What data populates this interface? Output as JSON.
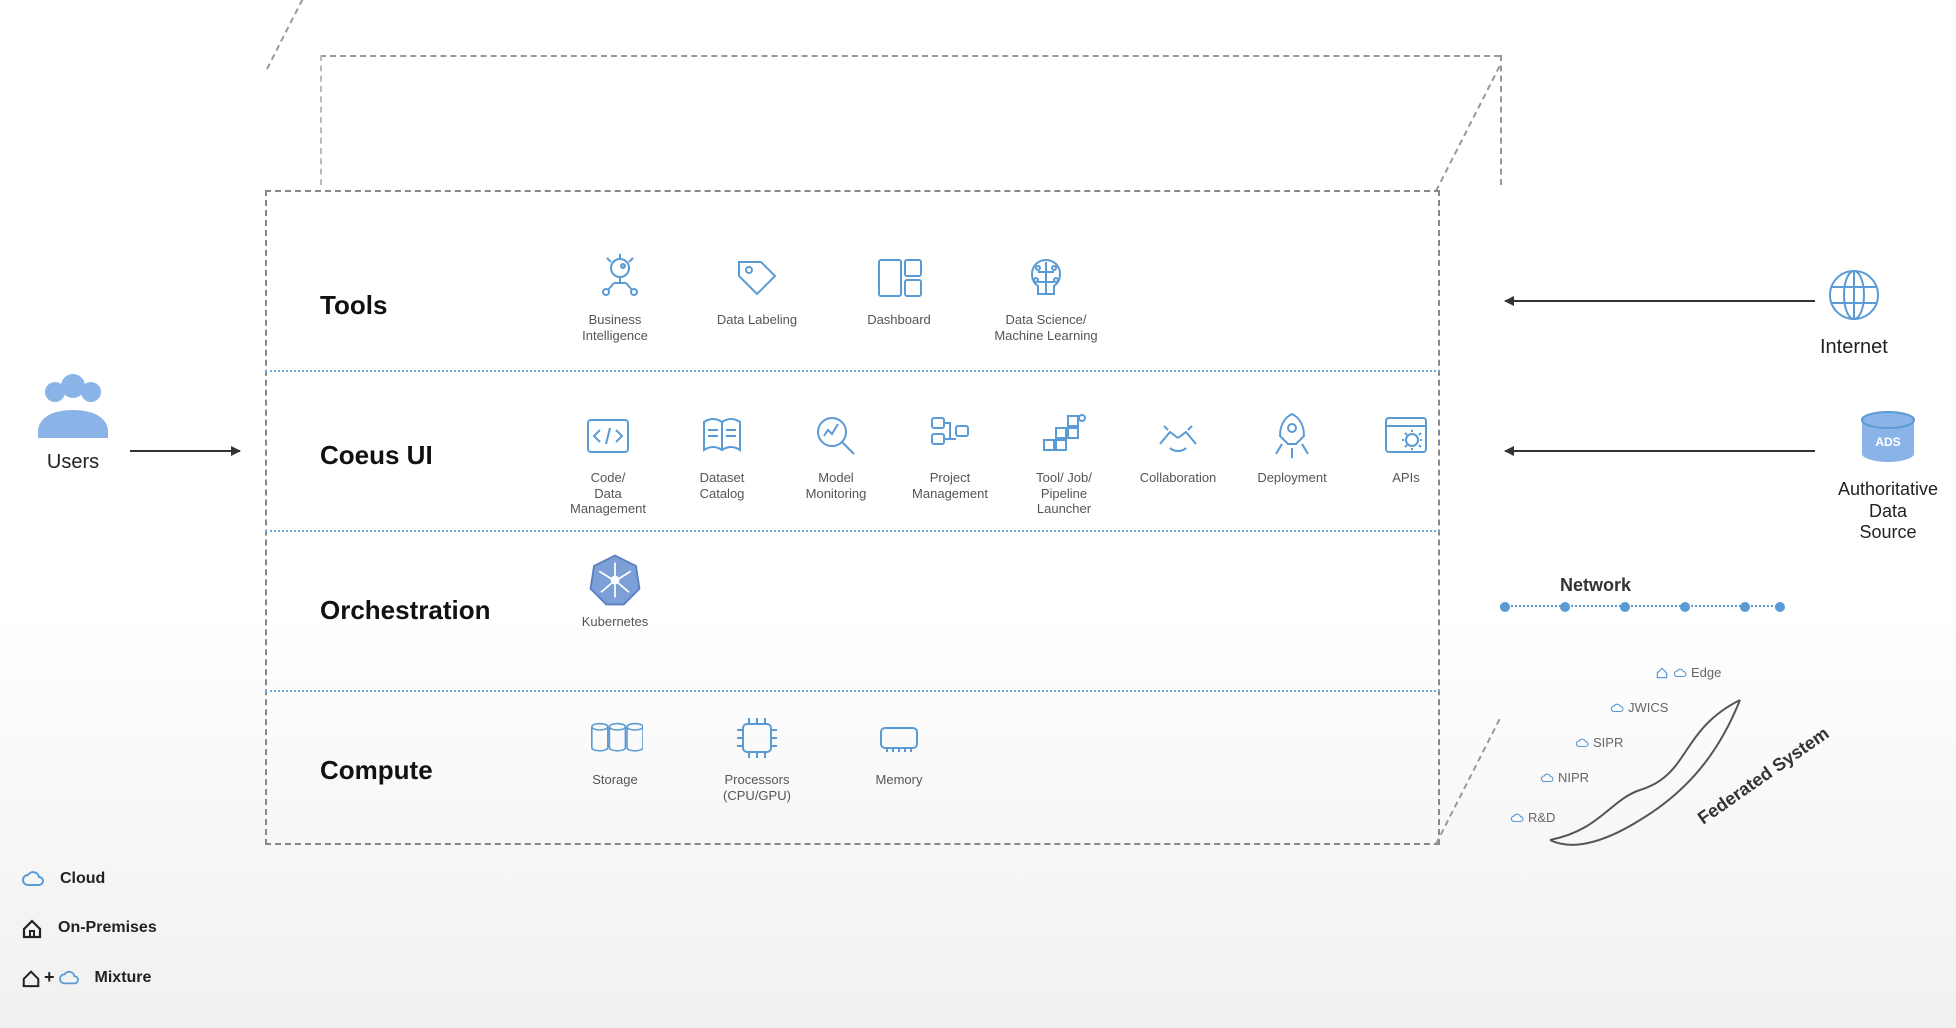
{
  "left": {
    "users": "Users"
  },
  "layers": {
    "tools": "Tools",
    "coeus": "Coeus UI",
    "orch": "Orchestration",
    "compute": "Compute"
  },
  "tools": {
    "bi": "Business\nIntelligence",
    "labeling": "Data Labeling",
    "dashboard": "Dashboard",
    "ml": "Data Science/\nMachine Learning"
  },
  "coeus": {
    "code": "Code/\nData Management",
    "catalog": "Dataset\nCatalog",
    "monitor": "Model\nMonitoring",
    "project": "Project\nManagement",
    "pipeline": "Tool/ Job/\nPipeline Launcher",
    "collab": "Collaboration",
    "deploy": "Deployment",
    "apis": "APIs"
  },
  "orch": {
    "k8s": "Kubernetes"
  },
  "compute": {
    "storage": "Storage",
    "proc": "Processors\n(CPU/GPU)",
    "memory": "Memory"
  },
  "right": {
    "internet": "Internet",
    "ads": "Authoritative Data\nSource",
    "ads_badge": "ADS"
  },
  "network": {
    "label": "Network",
    "tiers": [
      "R&D",
      "NIPR",
      "SIPR",
      "JWICS",
      "Edge"
    ],
    "fed": "Federated System"
  },
  "legend": {
    "cloud": "Cloud",
    "onprem": "On-Premises",
    "mix": "Mixture"
  }
}
